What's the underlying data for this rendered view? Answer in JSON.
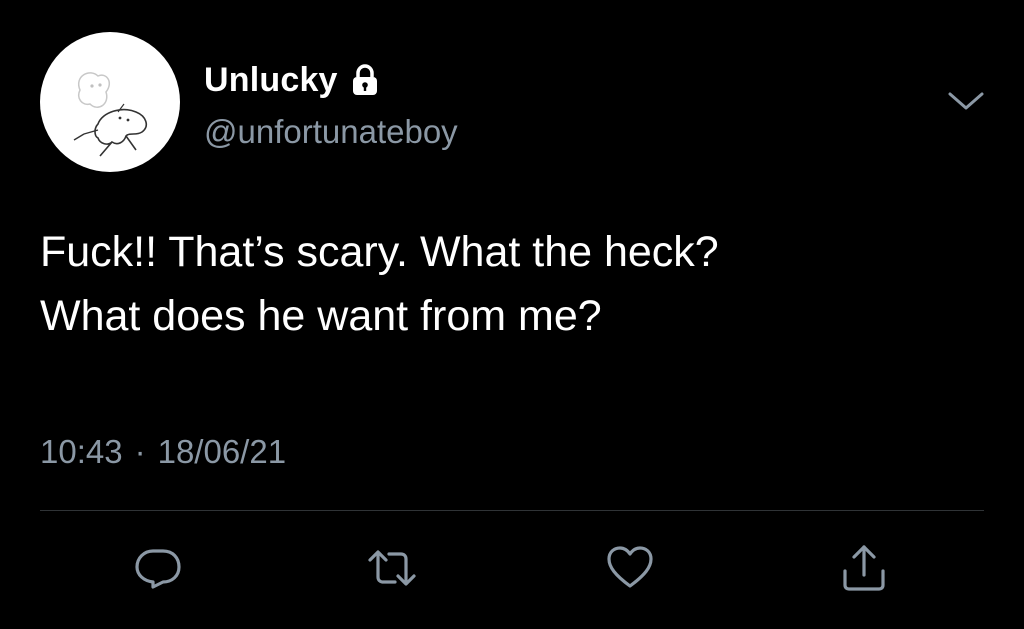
{
  "author": {
    "display_name": "Unlucky",
    "handle": "@unfortunateboy",
    "protected_icon": "lock-icon",
    "avatar_icon": "cartoon-ghost-avatar"
  },
  "tweet": {
    "text_lines": [
      "Fuck!! That’s scary. What the heck?",
      "What does he want from me?"
    ],
    "time": "10:43",
    "separator": "·",
    "date": "18/06/21"
  },
  "menu": {
    "icon": "chevron-down-icon"
  },
  "actions": [
    {
      "name": "reply",
      "icon": "reply-icon"
    },
    {
      "name": "retweet",
      "icon": "retweet-icon"
    },
    {
      "name": "like",
      "icon": "heart-icon"
    },
    {
      "name": "share",
      "icon": "share-icon"
    }
  ],
  "colors": {
    "background": "#000000",
    "primary_text": "#ffffff",
    "secondary_text": "#8b98a5",
    "divider": "#2f3336",
    "icon": "#8b98a5"
  }
}
